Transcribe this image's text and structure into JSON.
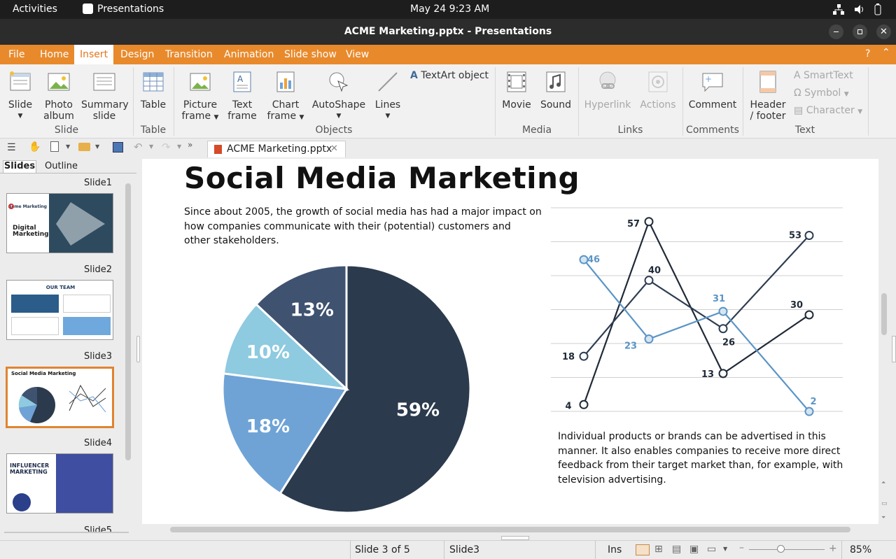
{
  "system": {
    "activities": "Activities",
    "app_name": "Presentations",
    "clock": "May 24  9:23 AM"
  },
  "window": {
    "title": "ACME Marketing.pptx - Presentations"
  },
  "menu": [
    "File",
    "Home",
    "Insert",
    "Design",
    "Transition",
    "Animation",
    "Slide show",
    "View"
  ],
  "ribbon": {
    "slide": "Slide",
    "photo_album_1": "Photo",
    "photo_album_2": "album",
    "summary_1": "Summary",
    "summary_2": "slide",
    "table": "Table",
    "picture_1": "Picture",
    "picture_2": "frame",
    "text_1": "Text",
    "text_2": "frame",
    "chart_1": "Chart",
    "chart_2": "frame",
    "autoshape": "AutoShape",
    "lines": "Lines",
    "textart": "TextArt object",
    "movie": "Movie",
    "sound": "Sound",
    "hyperlink": "Hyperlink",
    "actions": "Actions",
    "comment": "Comment",
    "header_1": "Header",
    "header_2": "/ footer",
    "smarttext": "SmartText",
    "symbol": "Symbol",
    "character": "Character",
    "groups": {
      "slide": "Slide",
      "table": "Table",
      "objects": "Objects",
      "media": "Media",
      "links": "Links",
      "comments": "Comments",
      "text": "Text"
    }
  },
  "doc_tab": "ACME Marketing.pptx",
  "sidebar": {
    "tabs": {
      "slides": "Slides",
      "outline": "Outline"
    },
    "slides": [
      "Slide1",
      "Slide2",
      "Slide3",
      "Slide4",
      "Slide5"
    ],
    "thumb1": {
      "title_1": "Digital",
      "title_2": "Marketing",
      "brand": "Acme Marketing"
    },
    "thumb2": {
      "title": "OUR TEAM"
    },
    "thumb3": {
      "title": "Social Media Marketing"
    },
    "thumb4": {
      "title_1": "INFLUENCER",
      "title_2": "MARKETING"
    }
  },
  "slide": {
    "title": "Social Media Marketing",
    "intro_1": "Since about 2005, the growth of social media has had a major impact on",
    "intro_2": "how companies communicate with their (potential) customers and",
    "intro_3": "other stakeholders.",
    "outro_1": "Individual products or brands can be advertised in this",
    "outro_2": "manner. It also enables companies to receive more direct",
    "outro_3": "feedback from their target market than, for example, with",
    "outro_4": "television advertising."
  },
  "chart_data": [
    {
      "type": "pie",
      "slices": [
        {
          "label": "59%",
          "value": 59,
          "color": "#2b3a4d"
        },
        {
          "label": "18%",
          "value": 18,
          "color": "#6fa3d6"
        },
        {
          "label": "10%",
          "value": 10,
          "color": "#8ecae0"
        },
        {
          "label": "13%",
          "value": 13,
          "color": "#3f5270"
        }
      ]
    },
    {
      "type": "line",
      "grid": true,
      "series": [
        {
          "color": "#1f2a38",
          "values": [
            4,
            57,
            13,
            30
          ]
        },
        {
          "color": "#2e3d52",
          "values": [
            18,
            40,
            26,
            53
          ]
        },
        {
          "color": "#5b95c6",
          "values": [
            46,
            23,
            31,
            2
          ]
        }
      ]
    }
  ],
  "status": {
    "slide_pos": "Slide 3 of 5",
    "slide_name": "Slide3",
    "mode": "Ins",
    "zoom": "85%"
  },
  "colors": {
    "accent": "#e88a2c",
    "selected_thumb": "#e08430"
  }
}
